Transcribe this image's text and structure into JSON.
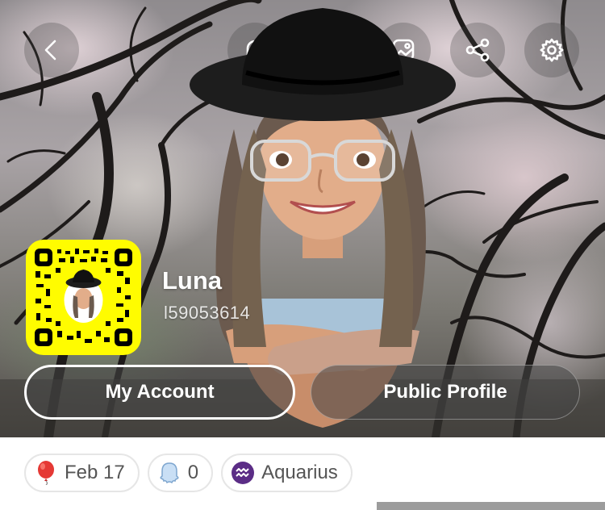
{
  "header": {
    "back_icon": "chevron-left-icon",
    "actions": [
      {
        "name": "notifications",
        "icon": "bell-icon"
      },
      {
        "name": "wardrobe",
        "icon": "hanger-icon"
      },
      {
        "name": "background",
        "icon": "image-icon"
      },
      {
        "name": "share",
        "icon": "share-icon"
      },
      {
        "name": "settings",
        "icon": "gear-icon"
      }
    ]
  },
  "profile": {
    "display_name": "Luna",
    "username": "l59053614",
    "snapcode_color": "#fffc00"
  },
  "buttons": {
    "my_account": "My Account",
    "public_profile": "Public Profile"
  },
  "chips": {
    "birthday": "Feb 17",
    "birthday_icon": "balloon-icon",
    "friends_count": "0",
    "friends_icon": "ghost-icon",
    "zodiac": "Aquarius",
    "zodiac_icon": "aquarius-icon"
  }
}
